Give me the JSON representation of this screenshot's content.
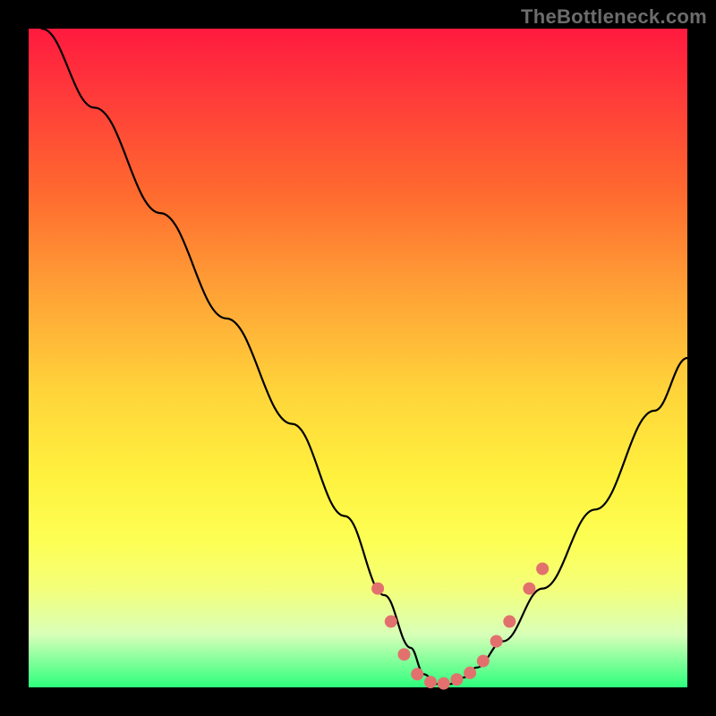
{
  "watermark": "TheBottleneck.com",
  "chart_data": {
    "type": "line",
    "title": "",
    "xlabel": "",
    "ylabel": "",
    "xlim": [
      0,
      100
    ],
    "ylim": [
      0,
      100
    ],
    "grid": false,
    "legend": false,
    "series": [
      {
        "name": "bottleneck-curve",
        "color": "#000000",
        "x": [
          2,
          10,
          20,
          30,
          40,
          48,
          54,
          58,
          60,
          62,
          64,
          66,
          68,
          72,
          78,
          86,
          95,
          100
        ],
        "y": [
          100,
          88,
          72,
          56,
          40,
          26,
          14,
          6,
          2,
          0.5,
          0.5,
          1.5,
          3,
          7,
          15,
          27,
          42,
          50
        ]
      }
    ],
    "markers": {
      "name": "highlighted-points",
      "color": "#e2716e",
      "radius_px": 7,
      "x": [
        53,
        55,
        57,
        59,
        61,
        63,
        65,
        67,
        69,
        71,
        73,
        76,
        78
      ],
      "y": [
        15,
        10,
        5,
        2,
        0.8,
        0.6,
        1.2,
        2.2,
        4,
        7,
        10,
        15,
        18
      ]
    }
  }
}
